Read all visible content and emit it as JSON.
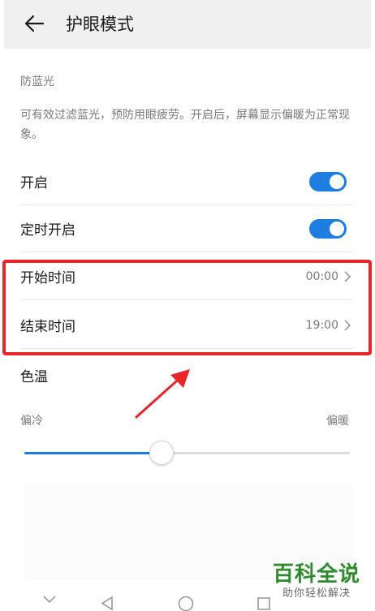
{
  "header": {
    "title": "护眼模式"
  },
  "blue_light": {
    "section_label": "防蓝光",
    "description": "可有效过滤蓝光，预防用眼疲劳。开启后，屏幕显示偏暖为正常现象。"
  },
  "rows": {
    "enable": {
      "label": "开启",
      "state": "on"
    },
    "schedule": {
      "label": "定时开启",
      "state": "on"
    },
    "start_time": {
      "label": "开始时间",
      "value": "00:00"
    },
    "end_time": {
      "label": "结束时间",
      "value": "19:00"
    }
  },
  "color_temperature": {
    "label": "色温",
    "cool_label": "偏冷",
    "warm_label": "偏暖",
    "level": 0.42
  },
  "colors": {
    "accent": "#1e7ee0",
    "highlight": "#e8262a",
    "watermark": "#2e8b2e"
  },
  "watermark": {
    "main": "百科全说",
    "sub": "助你轻松解决"
  },
  "icons": {
    "back": "arrow-left-icon",
    "chevron": "chevron-right-icon",
    "nav_down": "chevron-down-icon",
    "nav_back": "triangle-back-icon",
    "nav_home": "circle-home-icon",
    "nav_recent": "square-recent-icon"
  }
}
